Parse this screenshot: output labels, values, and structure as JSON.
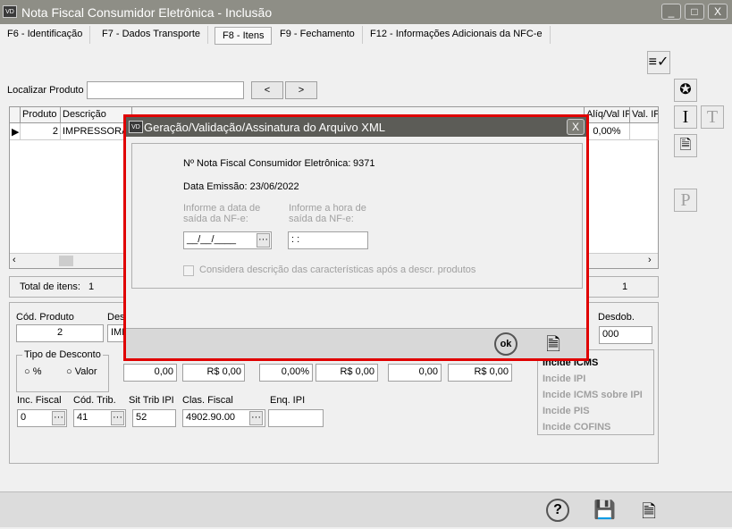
{
  "window": {
    "title": "Nota Fiscal Consumidor Eletrônica - Inclusão",
    "logo": "VD",
    "minimize": "_",
    "maximize": "□",
    "close": "X"
  },
  "tabs": [
    {
      "label": "F6 - Identificação"
    },
    {
      "label": "F7 - Dados Transporte"
    },
    {
      "label": "F8 - Itens",
      "active": true
    },
    {
      "label": "F9 - Fechamento"
    },
    {
      "label": "F12 - Informações Adicionais da NFC-e"
    }
  ],
  "search": {
    "label": "Localizar Produto",
    "value": "",
    "prev": "<",
    "next": ">"
  },
  "grid": {
    "columns": [
      "Produto",
      "Descrição",
      "Alíq/Val IPI",
      "Val. IP"
    ],
    "rows": [
      {
        "produto": "2",
        "descricao": "IMPRESSORA",
        "aliq": "0,00%",
        "val": ""
      }
    ]
  },
  "totals": {
    "label": "Total de itens:",
    "count": "1",
    "right_value": "1"
  },
  "form": {
    "cod_produto_label": "Cód. Produto",
    "cod_produto": "2",
    "descricao_label": "Des",
    "descricao": "IMP",
    "desdob_label": "Desdob.",
    "desdob": "000",
    "tipo_desconto": "Tipo de Desconto",
    "pct": "%",
    "valor": "Valor",
    "values": [
      "0,00",
      "R$ 0,00",
      "0,00%",
      "R$ 0,00",
      "0,00",
      "R$ 0,00"
    ],
    "inc_fiscal_label": "Inc. Fiscal",
    "inc_fiscal": "0",
    "cod_trib_label": "Cód. Trib.",
    "cod_trib": "41",
    "sit_trib_label": "Sit Trib IPI",
    "sit_trib": "52",
    "clas_fiscal_label": "Clas. Fiscal",
    "clas_fiscal": "4902.90.00",
    "enq_ipi_label": "Enq. IPI",
    "enq_ipi": "",
    "incide": [
      "Incide ICMS",
      "Incide IPI",
      "Incide ICMS sobre IPI",
      "Incide PIS",
      "Incide COFINS"
    ]
  },
  "dialog": {
    "title": "Geração/Validação/Assinatura do Arquivo XML",
    "logo": "VD",
    "close": "X",
    "nf_label": "Nº Nota Fiscal Consumidor Eletrônica:",
    "nf_value": "9371",
    "emissao": "Data Emissão: 23/06/2022",
    "data_saida_label": "Informe a data de saída da NF-e:",
    "data_saida": "__/__/____",
    "hora_saida_label": "Informe a hora de saída da NF-e:",
    "hora_saida": " :  :",
    "considera": "Considera descrição das características após a descr. produtos",
    "ok": "ok"
  },
  "sidebar": {
    "T": "T",
    "I": "I",
    "P": "P"
  }
}
